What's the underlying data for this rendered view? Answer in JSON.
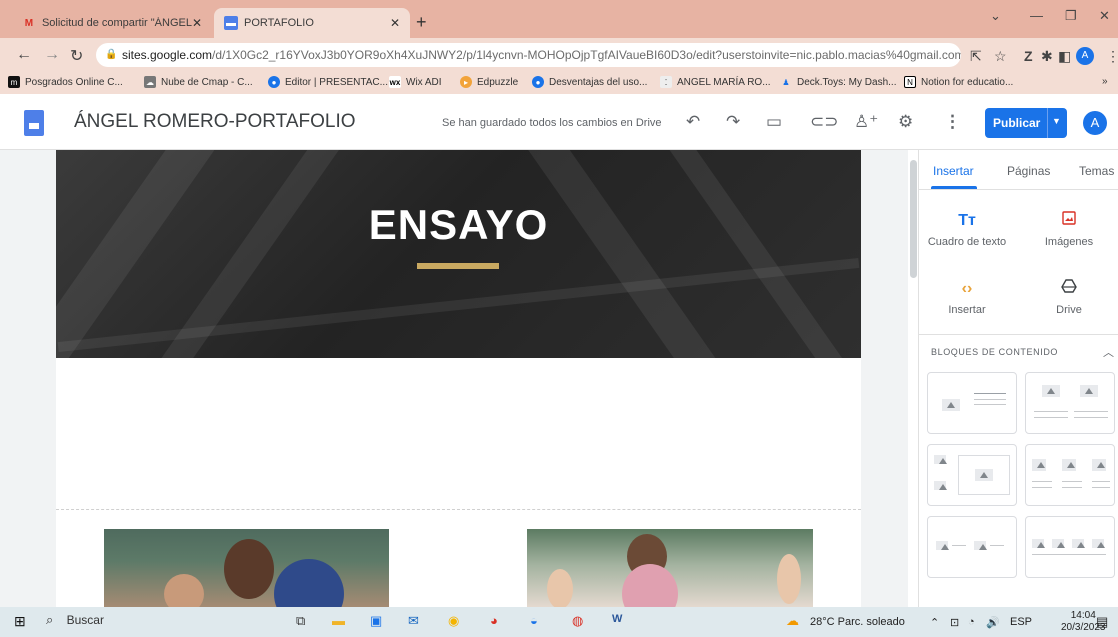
{
  "browser": {
    "tabs": [
      {
        "label": "Solicitud de compartir \"ÁNGEL R",
        "icon": "gmail-icon"
      },
      {
        "label": "PORTAFOLIO",
        "icon": "sites-icon"
      }
    ],
    "url_domain": "sites.google.com",
    "url_path": "/d/1X0Gc2_r16YVoxJ3b0YOR9oXh4XuJNWY2/p/1l4ycnvn-MOHOpOjpTgfAIVaueBI60D3o/edit?userstoinvite=nic.pablo.macias%40gmail.com...",
    "profile_initial": "A",
    "bookmarks": [
      "Posgrados Online C...",
      "Nube de Cmap - C...",
      "Editor | PRESENTAC...",
      "Wix ADI",
      "Edpuzzle",
      "Desventajas del uso...",
      "ANGEL MARÍA RO...",
      "Deck.Toys: My Dash...",
      "Notion for educatio..."
    ],
    "more_bookmarks": "»"
  },
  "sites": {
    "title": "ÁNGEL ROMERO-PORTAFOLIO",
    "saved_message": "Se han guardado todos los cambios en Drive",
    "publish_label": "Publicar",
    "user_initial": "A"
  },
  "page": {
    "hero_title": "ENSAYO"
  },
  "panel": {
    "tabs": [
      "Insertar",
      "Páginas",
      "Temas"
    ],
    "tools": [
      {
        "label": "Cuadro de texto",
        "icon": "Tт"
      },
      {
        "label": "Imágenes",
        "icon": "image-icon"
      },
      {
        "label": "Insertar",
        "icon": "‹›"
      },
      {
        "label": "Drive",
        "icon": "drive-icon"
      }
    ],
    "section_title": "BLOQUES DE CONTENIDO"
  },
  "taskbar": {
    "search_label": "Buscar",
    "weather": "28°C  Parc. soleado",
    "language": "ESP",
    "time": "14:04",
    "date": "20/3/2023"
  },
  "colors": {
    "accent": "#1a73e8",
    "tab_strip": "#e7b3a3",
    "hero_underline": "#c9a961"
  }
}
